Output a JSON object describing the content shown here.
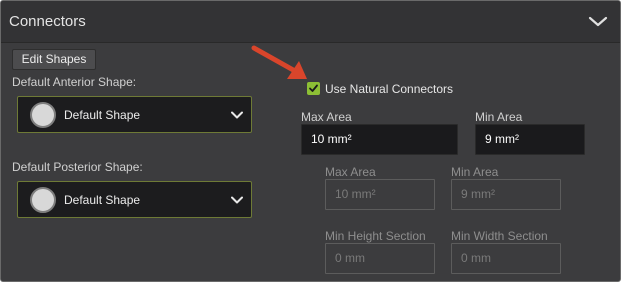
{
  "header": {
    "title": "Connectors",
    "chevron_icon": "chevron-down-icon"
  },
  "edit_shapes_label": "Edit Shapes",
  "anterior": {
    "label": "Default Anterior Shape:",
    "value": "Default Shape"
  },
  "posterior": {
    "label": "Default Posterior Shape:",
    "value": "Default Shape"
  },
  "natural": {
    "label": "Use Natural Connectors",
    "checked": true,
    "max_label": "Max Area",
    "max_value": "10 mm²",
    "min_label": "Min Area",
    "min_value": "9 mm²"
  },
  "disabled_group": {
    "max_label": "Max Area",
    "max_value": "10 mm²",
    "min_label": "Min Area",
    "min_value": "9 mm²",
    "min_height_label": "Min Height Section",
    "min_height_value": "0 mm",
    "min_width_label": "Min Width Section",
    "min_width_value": "0 mm"
  },
  "colors": {
    "accent": "#8dbf35",
    "arrow": "#d9452b",
    "panel_bg": "#3c3c3e"
  }
}
